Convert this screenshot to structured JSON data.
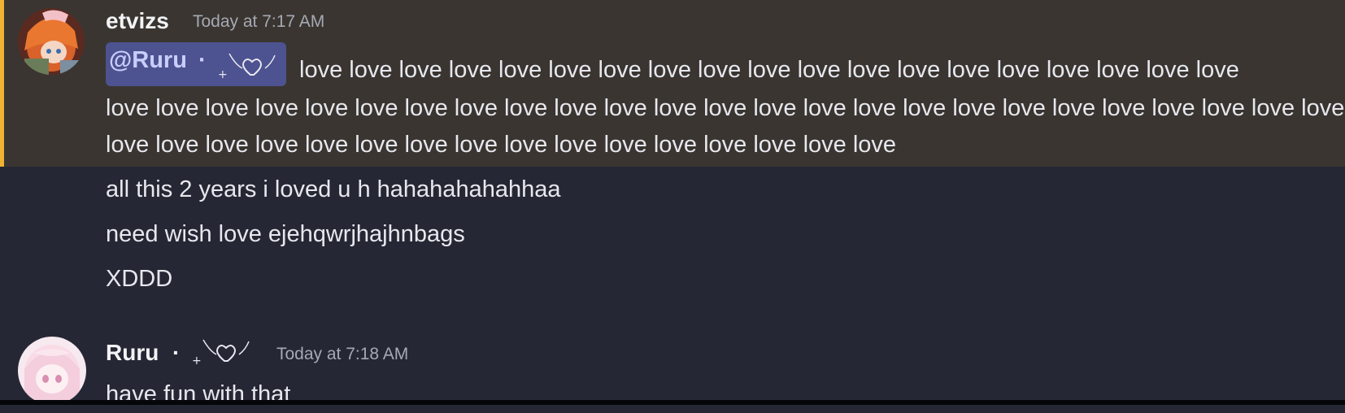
{
  "messages": [
    {
      "author": "etvizs",
      "timestamp": "Today at 7:17 AM",
      "mention": "@Ruru",
      "mention_suffix": "·",
      "line1": "love love love love love love love love love love love love love love love love love love love",
      "line2": "love love love love love love love love love love love love love love love love love love love love love love love love love lov",
      "line3": "love love love love love love love love love love love love love love love love"
    },
    {
      "text": "all this 2 years i loved u h hahahahahahhaa"
    },
    {
      "text": "need wish love ejehqwrjhajhnbags"
    },
    {
      "text": "XDDD"
    },
    {
      "author": "Ruru",
      "author_suffix": "·",
      "timestamp": "Today at 7:18 AM",
      "text": "have fun with that"
    }
  ],
  "colors": {
    "background": "#252734",
    "highlight_bg": "#3a3531",
    "highlight_border": "#f0b232",
    "mention_bg": "#4d5290",
    "mention_text": "#c9cdfb"
  },
  "icons": {
    "etvizs_avatar": "orange-haired-anime-avatar",
    "ruru_avatar": "pink-haired-anime-avatar",
    "name_decoration": "winged-heart-sparkle-icon"
  }
}
